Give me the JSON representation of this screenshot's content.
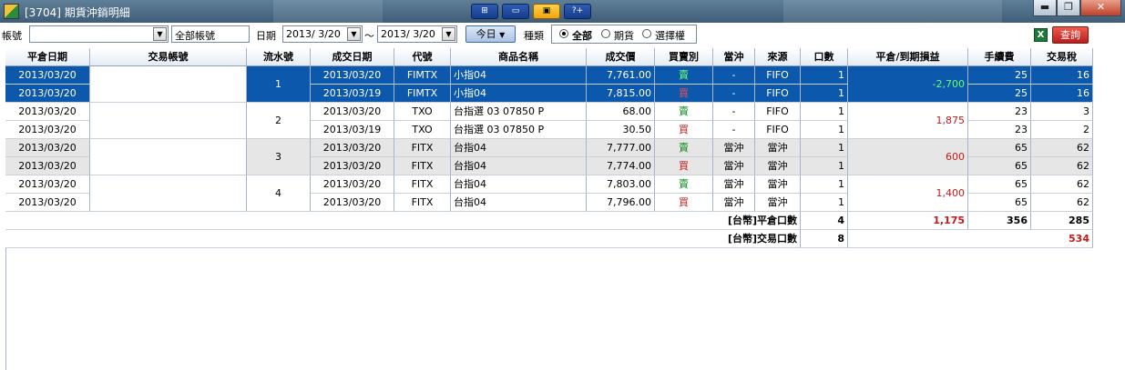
{
  "window": {
    "title": "[3704] 期貨沖銷明細",
    "min_label": "▬",
    "max_label": "❐",
    "close_label": "✕"
  },
  "title_buttons": [
    {
      "label": "⊞",
      "icon": "layout-icon"
    },
    {
      "label": "▭",
      "icon": "window-icon"
    },
    {
      "label": "▣",
      "icon": "pin-icon"
    },
    {
      "label": "?+",
      "icon": "help-icon"
    }
  ],
  "toolbar": {
    "account_label": "帳號",
    "account_value": "",
    "all_accounts": "全部帳號",
    "date_label": "日期",
    "date_from": "2013/ 3/20",
    "date_sep": "～",
    "date_to": "2013/ 3/20",
    "today_button": "今日",
    "type_label": "種類",
    "type_options": [
      "全部",
      "期貨",
      "選擇權"
    ],
    "type_selected": "全部",
    "export_icon": "excel-icon",
    "query_button": "查詢"
  },
  "colors": {
    "selected_row": "#0b58ad",
    "buy_red": "#c41a1a",
    "sell_green": "#0e8a1e",
    "alt_row_gray": "#e6e6e6"
  },
  "table": {
    "columns": [
      "平倉日期",
      "交易帳號",
      "流水號",
      "成交日期",
      "代號",
      "商品名稱",
      "成交價",
      "買賣別",
      "當沖",
      "來源",
      "口數",
      "平倉/到期損益",
      "手續費",
      "交易稅"
    ],
    "groups": [
      {
        "seq": "1",
        "account": "",
        "pnl": "-2,700",
        "rows": [
          {
            "close_date": "2013/03/20",
            "trade_date": "2013/03/20",
            "code": "FIMTX",
            "name": "小指04",
            "price": "7,761.00",
            "side": "賣",
            "daytrade": "-",
            "source": "FIFO",
            "qty": "1",
            "fee": "25",
            "tax": "16"
          },
          {
            "close_date": "2013/03/20",
            "trade_date": "2013/03/19",
            "code": "FIMTX",
            "name": "小指04",
            "price": "7,815.00",
            "side": "買",
            "daytrade": "-",
            "source": "FIFO",
            "qty": "1",
            "fee": "25",
            "tax": "16"
          }
        ]
      },
      {
        "seq": "2",
        "account": "",
        "pnl": "1,875",
        "rows": [
          {
            "close_date": "2013/03/20",
            "trade_date": "2013/03/20",
            "code": "TXO",
            "name": "台指選 03 07850 P",
            "price": "68.00",
            "side": "賣",
            "daytrade": "-",
            "source": "FIFO",
            "qty": "1",
            "fee": "23",
            "tax": "3"
          },
          {
            "close_date": "2013/03/20",
            "trade_date": "2013/03/19",
            "code": "TXO",
            "name": "台指選 03 07850 P",
            "price": "30.50",
            "side": "買",
            "daytrade": "-",
            "source": "FIFO",
            "qty": "1",
            "fee": "23",
            "tax": "2"
          }
        ]
      },
      {
        "seq": "3",
        "account": "",
        "pnl": "600",
        "rows": [
          {
            "close_date": "2013/03/20",
            "trade_date": "2013/03/20",
            "code": "FITX",
            "name": "台指04",
            "price": "7,777.00",
            "side": "賣",
            "daytrade": "當沖",
            "source": "當沖",
            "qty": "1",
            "fee": "65",
            "tax": "62"
          },
          {
            "close_date": "2013/03/20",
            "trade_date": "2013/03/20",
            "code": "FITX",
            "name": "台指04",
            "price": "7,774.00",
            "side": "買",
            "daytrade": "當沖",
            "source": "當沖",
            "qty": "1",
            "fee": "65",
            "tax": "62"
          }
        ]
      },
      {
        "seq": "4",
        "account": "",
        "pnl": "1,400",
        "rows": [
          {
            "close_date": "2013/03/20",
            "trade_date": "2013/03/20",
            "code": "FITX",
            "name": "台指04",
            "price": "7,803.00",
            "side": "賣",
            "daytrade": "當沖",
            "source": "當沖",
            "qty": "1",
            "fee": "65",
            "tax": "62"
          },
          {
            "close_date": "2013/03/20",
            "trade_date": "2013/03/20",
            "code": "FITX",
            "name": "台指04",
            "price": "7,796.00",
            "side": "買",
            "daytrade": "當沖",
            "source": "當沖",
            "qty": "1",
            "fee": "65",
            "tax": "62"
          }
        ]
      }
    ],
    "summary": {
      "close_label": "[台幣]平倉口數",
      "close_qty": "4",
      "close_pnl": "1,175",
      "close_fee": "356",
      "close_tax": "285",
      "trade_label": "[台幣]交易口數",
      "trade_qty": "8",
      "trade_tax": "534"
    }
  }
}
